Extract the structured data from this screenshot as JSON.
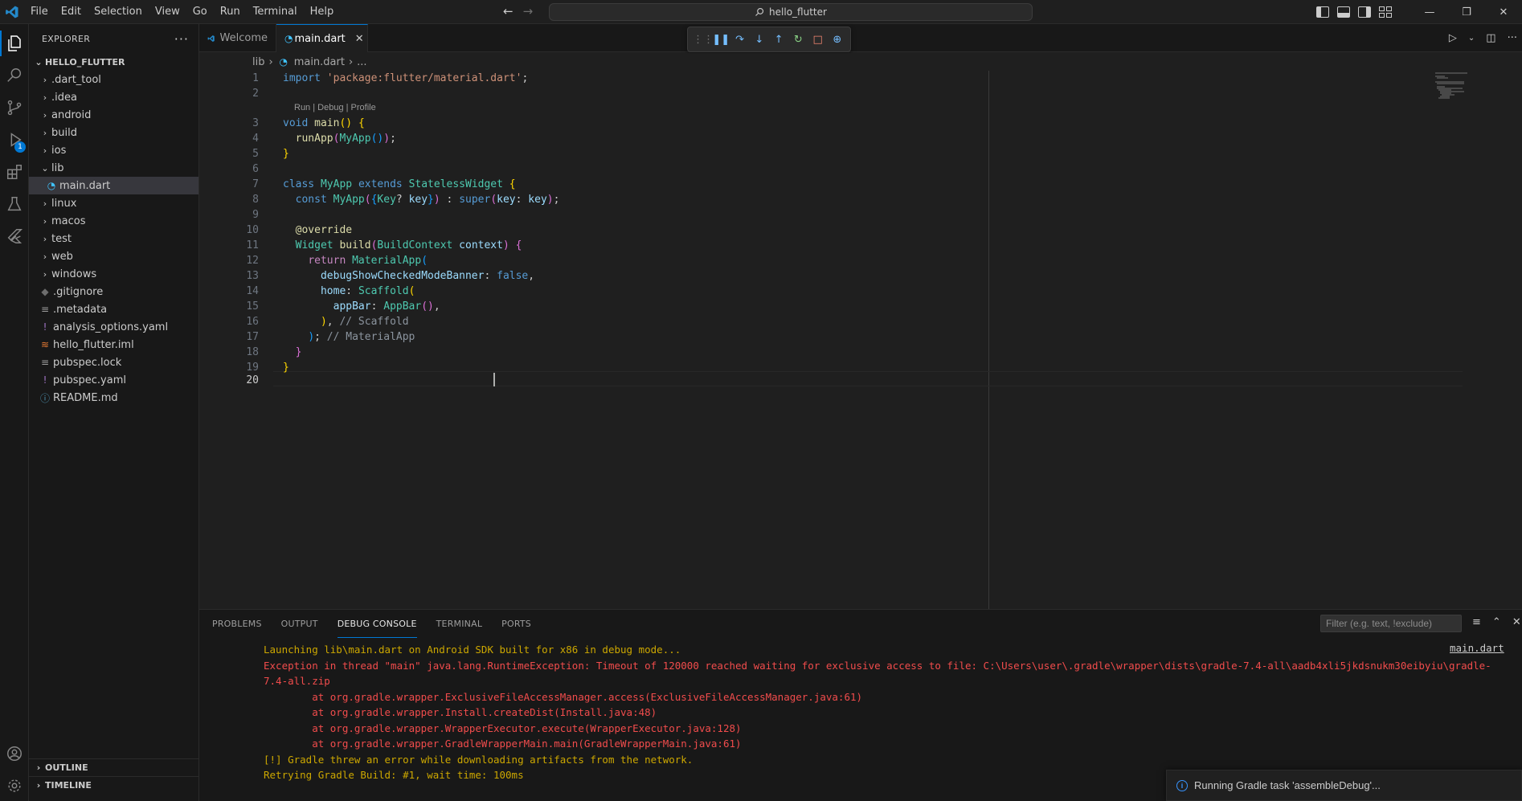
{
  "window": {
    "menu": [
      "File",
      "Edit",
      "Selection",
      "View",
      "Go",
      "Run",
      "Terminal",
      "Help"
    ],
    "search": "hello_flutter"
  },
  "sidebar": {
    "title": "EXPLORER",
    "root": "HELLO_FLUTTER",
    "items": [
      {
        "label": ".dart_tool",
        "type": "folder"
      },
      {
        "label": ".idea",
        "type": "folder"
      },
      {
        "label": "android",
        "type": "folder"
      },
      {
        "label": "build",
        "type": "folder"
      },
      {
        "label": "ios",
        "type": "folder"
      },
      {
        "label": "lib",
        "type": "folder-open"
      },
      {
        "label": "main.dart",
        "type": "dart"
      },
      {
        "label": "linux",
        "type": "folder"
      },
      {
        "label": "macos",
        "type": "folder"
      },
      {
        "label": "test",
        "type": "folder"
      },
      {
        "label": "web",
        "type": "folder"
      },
      {
        "label": "windows",
        "type": "folder"
      },
      {
        "label": ".gitignore",
        "type": "git"
      },
      {
        "label": ".metadata",
        "type": "meta"
      },
      {
        "label": "analysis_options.yaml",
        "type": "yaml"
      },
      {
        "label": "hello_flutter.iml",
        "type": "iml"
      },
      {
        "label": "pubspec.lock",
        "type": "lock"
      },
      {
        "label": "pubspec.yaml",
        "type": "yaml"
      },
      {
        "label": "README.md",
        "type": "info"
      }
    ],
    "outline": "OUTLINE",
    "timeline": "TIMELINE"
  },
  "activity": {
    "run_badge": "1"
  },
  "tabs": [
    {
      "label": "Welcome"
    },
    {
      "label": "main.dart"
    }
  ],
  "breadcrumb": {
    "folder": "lib",
    "file": "main.dart",
    "more": "..."
  },
  "editor": {
    "codelens": "Run | Debug | Profile",
    "line_numbers": [
      "1",
      "2",
      "3",
      "4",
      "5",
      "6",
      "7",
      "8",
      "9",
      "10",
      "11",
      "12",
      "13",
      "14",
      "15",
      "16",
      "17",
      "18",
      "19",
      "20"
    ]
  },
  "panel": {
    "tabs": [
      "PROBLEMS",
      "OUTPUT",
      "DEBUG CONSOLE",
      "TERMINAL",
      "PORTS"
    ],
    "active_tab": "DEBUG CONSOLE",
    "filter_placeholder": "Filter (e.g. text, !exclude)",
    "source_ref": "main.dart",
    "console_lines": [
      {
        "text": "Launching lib\\main.dart on Android SDK built for x86 in debug mode...",
        "color": "yellow"
      },
      {
        "text": "Exception in thread \"main\" java.lang.RuntimeException: Timeout of 120000 reached waiting for exclusive access to file: C:\\Users\\user\\.gradle\\wrapper\\dists\\gradle-7.4-all\\aadb4xli5jkdsnukm30eibyiu\\gradle-",
        "color": "red"
      },
      {
        "text": "7.4-all.zip",
        "color": "red"
      },
      {
        "text": "        at org.gradle.wrapper.ExclusiveFileAccessManager.access(ExclusiveFileAccessManager.java:61)",
        "color": "red"
      },
      {
        "text": "        at org.gradle.wrapper.Install.createDist(Install.java:48)",
        "color": "red"
      },
      {
        "text": "        at org.gradle.wrapper.WrapperExecutor.execute(WrapperExecutor.java:128)",
        "color": "red"
      },
      {
        "text": "        at org.gradle.wrapper.GradleWrapperMain.main(GradleWrapperMain.java:61)",
        "color": "red"
      },
      {
        "text": "[!] Gradle threw an error while downloading artifacts from the network.",
        "color": "yellow"
      },
      {
        "text": "Retrying Gradle Build: #1, wait time: 100ms",
        "color": "yellow"
      }
    ]
  },
  "notification": {
    "text": "Running Gradle task 'assembleDebug'..."
  },
  "colors": {
    "accent": "#0078d4",
    "console_yellow": "#cca700",
    "console_red": "#f14c4c"
  }
}
